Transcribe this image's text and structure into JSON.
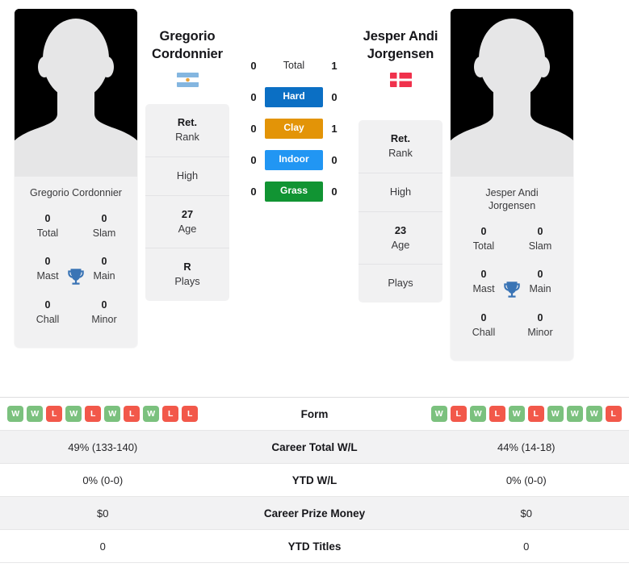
{
  "players": {
    "left": {
      "name": "Gregorio Cordonnier",
      "name_line1": "Gregorio",
      "name_line2": "Cordonnier",
      "photo_name": "Gregorio Cordonnier",
      "country": "Argentina",
      "flag_icon": "argentina-flag-icon",
      "info": [
        {
          "value": "Ret.",
          "label": "Rank"
        },
        {
          "value": "",
          "label": "High"
        },
        {
          "value": "27",
          "label": "Age"
        },
        {
          "value": "R",
          "label": "Plays"
        }
      ],
      "titles": [
        {
          "value": "0",
          "label": "Total"
        },
        {
          "value": "0",
          "label": "Slam"
        },
        {
          "value": "0",
          "label": "Mast"
        },
        {
          "value": "0",
          "label": "Main"
        },
        {
          "value": "0",
          "label": "Chall"
        },
        {
          "value": "0",
          "label": "Minor"
        }
      ],
      "form": [
        "W",
        "W",
        "L",
        "W",
        "L",
        "W",
        "L",
        "W",
        "L",
        "L"
      ],
      "career_total_wl": "49% (133-140)",
      "ytd_wl": "0% (0-0)",
      "career_prize_money": "$0",
      "ytd_titles": "0"
    },
    "right": {
      "name": "Jesper Andi Jorgensen",
      "name_line1": "Jesper Andi",
      "name_line2": "Jorgensen",
      "photo_name_line1": "Jesper Andi",
      "photo_name_line2": "Jorgensen",
      "country": "Denmark",
      "flag_icon": "denmark-flag-icon",
      "info": [
        {
          "value": "Ret.",
          "label": "Rank"
        },
        {
          "value": "",
          "label": "High"
        },
        {
          "value": "23",
          "label": "Age"
        },
        {
          "value": "",
          "label": "Plays"
        }
      ],
      "titles": [
        {
          "value": "0",
          "label": "Total"
        },
        {
          "value": "0",
          "label": "Slam"
        },
        {
          "value": "0",
          "label": "Mast"
        },
        {
          "value": "0",
          "label": "Main"
        },
        {
          "value": "0",
          "label": "Chall"
        },
        {
          "value": "0",
          "label": "Minor"
        }
      ],
      "form": [
        "W",
        "L",
        "W",
        "L",
        "W",
        "L",
        "W",
        "W",
        "W",
        "L"
      ],
      "career_total_wl": "44% (14-18)",
      "ytd_wl": "0% (0-0)",
      "career_prize_money": "$0",
      "ytd_titles": "0"
    }
  },
  "head_to_head": {
    "rows": [
      {
        "label": "Total",
        "left": "0",
        "right": "1",
        "color": "",
        "styled": false
      },
      {
        "label": "Hard",
        "left": "0",
        "right": "0",
        "color": "#0b6fc4",
        "styled": true
      },
      {
        "label": "Clay",
        "left": "0",
        "right": "1",
        "color": "#e39407",
        "styled": true
      },
      {
        "label": "Indoor",
        "left": "0",
        "right": "0",
        "color": "#2196f3",
        "styled": true
      },
      {
        "label": "Grass",
        "left": "0",
        "right": "0",
        "color": "#119433",
        "styled": true
      }
    ]
  },
  "stats_table": {
    "rows": [
      {
        "label": "Form",
        "left": "",
        "right": "",
        "type": "form",
        "shaded": false
      },
      {
        "label": "Career Total W/L",
        "left": "49% (133-140)",
        "right": "44% (14-18)",
        "type": "text",
        "shaded": true
      },
      {
        "label": "YTD W/L",
        "left": "0% (0-0)",
        "right": "0% (0-0)",
        "type": "text",
        "shaded": false
      },
      {
        "label": "Career Prize Money",
        "left": "$0",
        "right": "$0",
        "type": "text",
        "shaded": true
      },
      {
        "label": "YTD Titles",
        "left": "0",
        "right": "0",
        "type": "text",
        "shaded": false
      }
    ]
  },
  "colors": {
    "win_badge": "#7bc17e",
    "loss_badge": "#f2584a",
    "trophy": "#3a74b5",
    "card_bg": "#f1f1f2"
  },
  "icons": {
    "trophy": "trophy-icon",
    "avatar": "avatar-placeholder-icon"
  }
}
